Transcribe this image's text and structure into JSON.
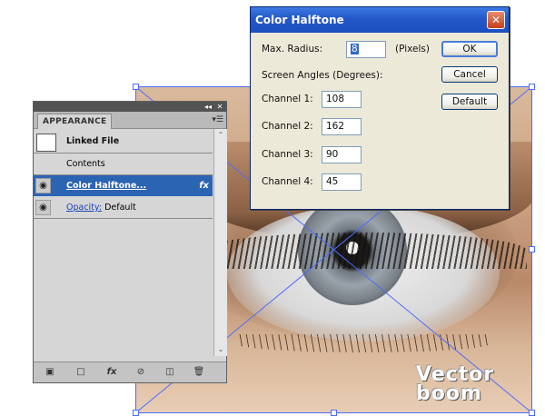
{
  "panel": {
    "tab_label": "APPEARANCE",
    "rows": [
      {
        "label": "Linked File"
      },
      {
        "label": "Contents"
      },
      {
        "label": "Color Halftone...",
        "fx": "fx"
      },
      {
        "opacity_label": "Opacity:",
        "opacity_value": "Default"
      }
    ],
    "bottom_icons": [
      "add-new-stroke-icon",
      "add-new-fill-icon",
      "add-new-effect-icon",
      "clear-appearance-icon",
      "duplicate-item-icon",
      "delete-item-icon"
    ],
    "bottom_fx_label": "fx"
  },
  "dialog": {
    "title": "Color Halftone",
    "max_radius_label": "Max. Radius:",
    "max_radius_value": "8",
    "pixels_label": "(Pixels)",
    "screen_angles_label": "Screen Angles (Degrees):",
    "channels": [
      {
        "label": "Channel 1:",
        "value": "108"
      },
      {
        "label": "Channel 2:",
        "value": "162"
      },
      {
        "label": "Channel 3:",
        "value": "90"
      },
      {
        "label": "Channel 4:",
        "value": "45"
      }
    ],
    "ok_label": "OK",
    "cancel_label": "Cancel",
    "default_label": "Default"
  },
  "watermark": {
    "line1": "Vector",
    "line2": "boom"
  },
  "colors": {
    "selection": "#2c64b4",
    "dialog_title": "#2457c9",
    "bbox_line": "#4a6cff"
  }
}
